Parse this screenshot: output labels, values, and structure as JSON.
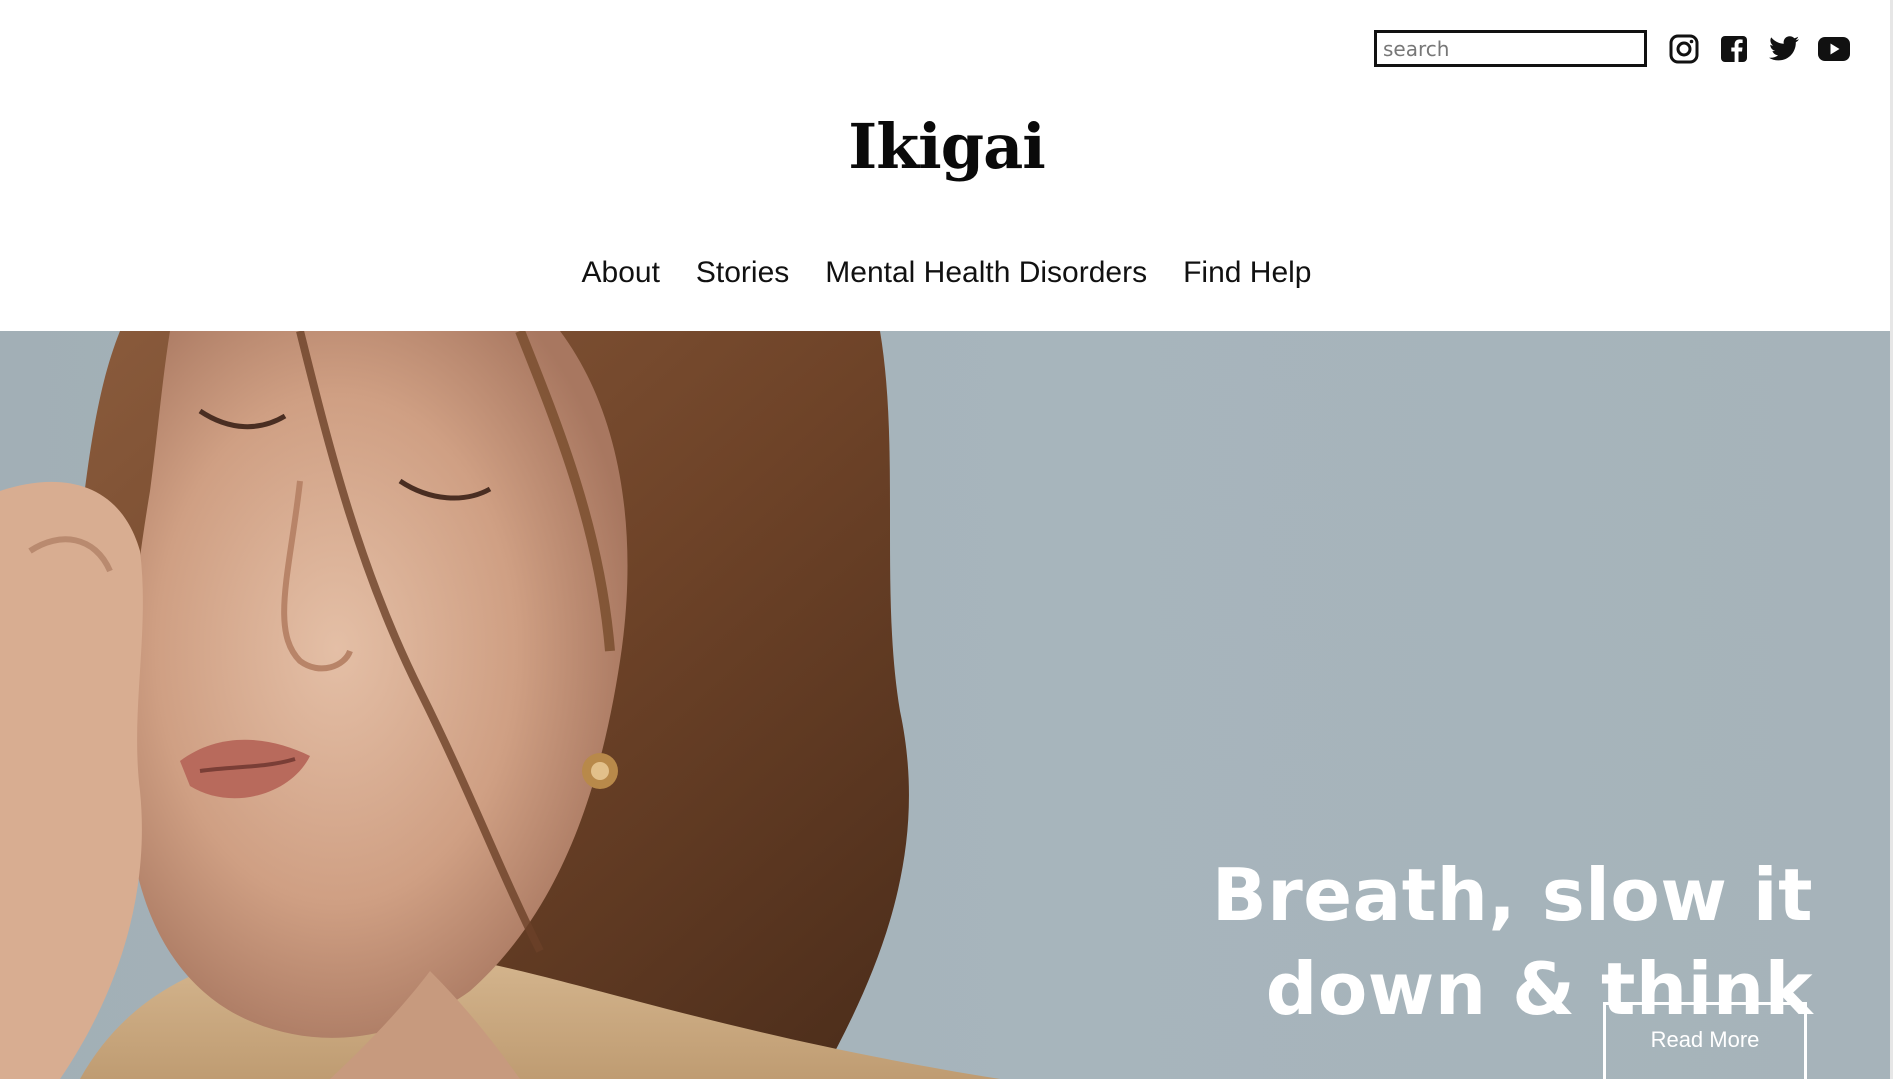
{
  "header": {
    "search": {
      "placeholder": "search",
      "value": ""
    },
    "social": [
      {
        "name": "Instagram",
        "icon": "instagram-icon"
      },
      {
        "name": "Facebook",
        "icon": "facebook-icon"
      },
      {
        "name": "Twitter",
        "icon": "twitter-icon"
      },
      {
        "name": "YouTube",
        "icon": "youtube-icon"
      }
    ],
    "logo": "Ikigai"
  },
  "nav": {
    "items": [
      {
        "label": "About"
      },
      {
        "label": "Stories"
      },
      {
        "label": "Mental Health Disorders"
      },
      {
        "label": "Find Help"
      }
    ]
  },
  "hero": {
    "heading_line1": "Breath, slow it",
    "heading_line2": "down & think",
    "button_label": "Read More",
    "background_color": "#a6b3ba"
  }
}
